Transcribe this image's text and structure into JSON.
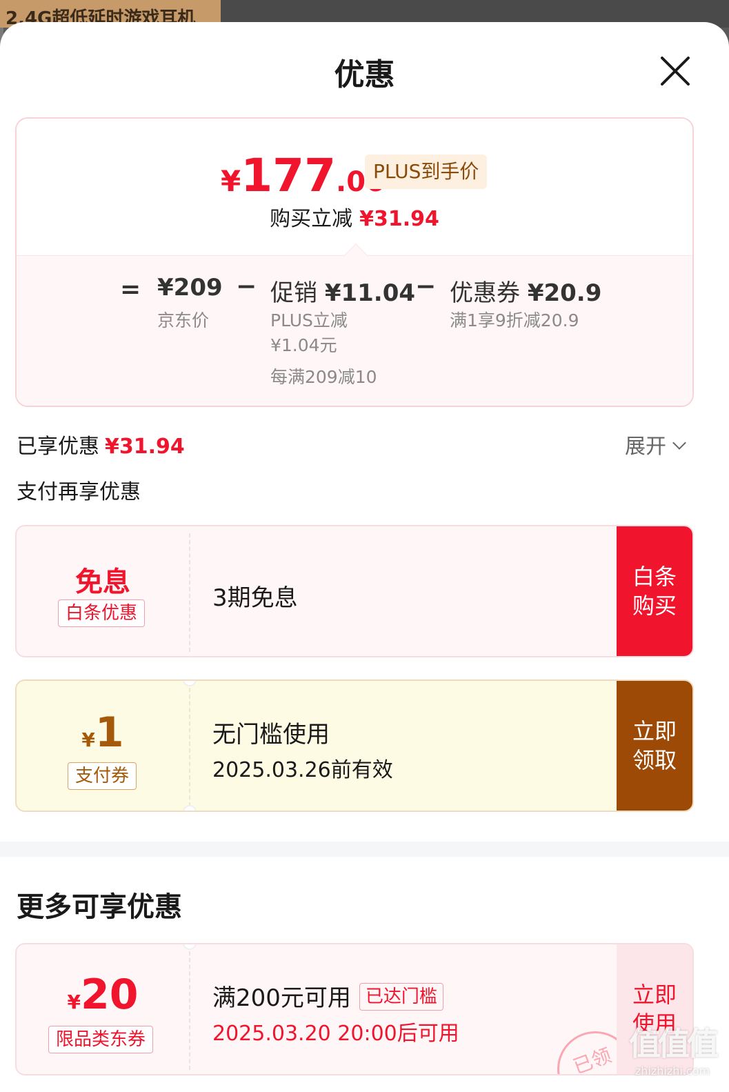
{
  "background": {
    "product_tag": "2.4G超低延时游戏耳机"
  },
  "header": {
    "title": "优惠",
    "close_icon": "close-icon"
  },
  "price_card": {
    "currency": "¥",
    "final_int": "177",
    "final_dec": ".06",
    "plus_badge": "PLUS到手价",
    "reduce_label": "购买立减",
    "reduce_amount": "¥31.94",
    "breakdown": {
      "eq": "=",
      "jd_price": "¥209",
      "jd_label": "京东价",
      "minus1": "−",
      "promo_label": "促销",
      "promo_amount": "¥11.04",
      "promo_sub1": "PLUS立减",
      "promo_sub2": "¥1.04元",
      "promo_sub3": "每满209减10",
      "minus2": "−",
      "coupon_label": "优惠券",
      "coupon_amount": "¥20.9",
      "coupon_sub": "满1享9折减20.9"
    }
  },
  "enjoyed": {
    "label": "已享优惠",
    "amount": "¥31.94",
    "expand": "展开"
  },
  "pay_more": {
    "title": "支付再享优惠"
  },
  "coupons": [
    {
      "big": "免息",
      "tag": "白条优惠",
      "desc": "3期免息",
      "action": "白条购买"
    },
    {
      "currency": "¥",
      "amount": "1",
      "tag": "支付券",
      "desc1": "无门槛使用",
      "desc2": "2025.03.26前有效",
      "action": "立即领取"
    }
  ],
  "more": {
    "title": "更多可享优惠",
    "coupon": {
      "currency": "¥",
      "amount": "20",
      "tag": "限品类东券",
      "desc1": "满200元可用",
      "reached": "已达门槛",
      "desc2": "2025.03.20 20:00后可用",
      "action": "立即使用",
      "stamp": "已领"
    }
  },
  "watermark": {
    "logo": "值",
    "text": "zhizhizhi.com"
  },
  "colors": {
    "accent_red": "#f0142d",
    "brown": "#9c4a06",
    "plus_gold": "#8a4a0a"
  }
}
